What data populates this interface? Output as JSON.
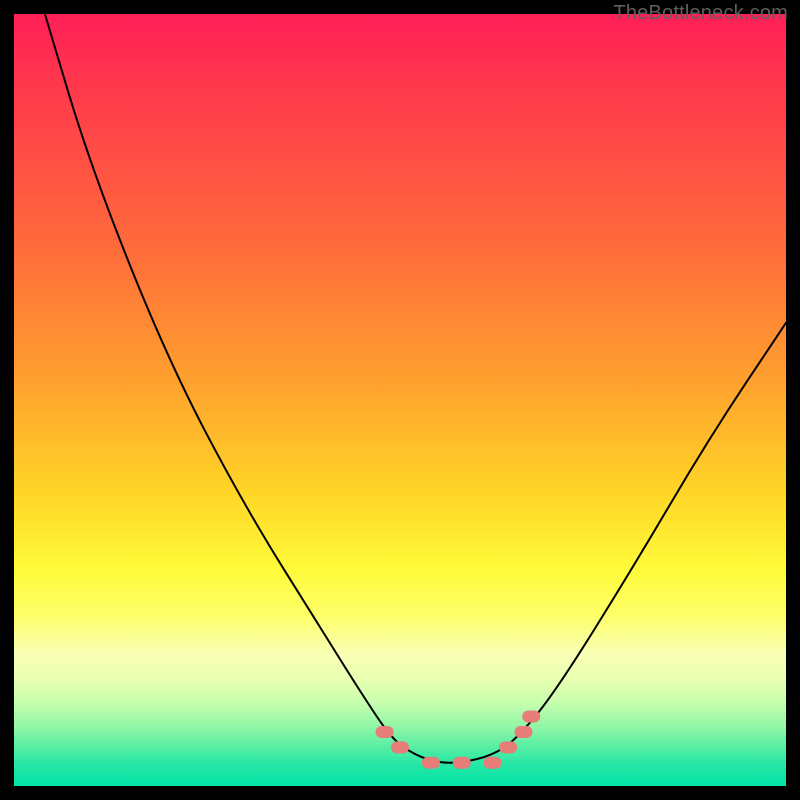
{
  "watermark": {
    "text": "TheBottleneck.com"
  },
  "chart_data": {
    "type": "line",
    "title": "",
    "xlabel": "",
    "ylabel": "",
    "xlim": [
      0,
      100
    ],
    "ylim": [
      0,
      100
    ],
    "grid": false,
    "legend": false,
    "annotations": [],
    "background_gradient": {
      "orientation": "vertical",
      "stops": [
        {
          "pos": 0.0,
          "color": "#ff1f57"
        },
        {
          "pos": 0.3,
          "color": "#ff6a3b"
        },
        {
          "pos": 0.62,
          "color": "#ffd527"
        },
        {
          "pos": 0.82,
          "color": "#f9ffb5"
        },
        {
          "pos": 1.0,
          "color": "#00e3a6"
        }
      ]
    },
    "series": [
      {
        "name": "bottleneck_curve",
        "stroke": "#000000",
        "stroke_width": 2,
        "x": [
          4,
          10,
          20,
          30,
          40,
          45,
          49,
          52,
          55,
          58,
          62,
          65,
          70,
          80,
          90,
          100
        ],
        "y": [
          100,
          80,
          55,
          36,
          20,
          12,
          6,
          4,
          3,
          3,
          4,
          6,
          12,
          28,
          45,
          60
        ]
      }
    ],
    "markers": {
      "color": "#e77d78",
      "shape": "rounded-segment",
      "points": [
        {
          "x": 48,
          "y": 7
        },
        {
          "x": 50,
          "y": 5
        },
        {
          "x": 54,
          "y": 3
        },
        {
          "x": 58,
          "y": 3
        },
        {
          "x": 62,
          "y": 3
        },
        {
          "x": 64,
          "y": 5
        },
        {
          "x": 66,
          "y": 7
        },
        {
          "x": 67,
          "y": 9
        }
      ]
    }
  }
}
